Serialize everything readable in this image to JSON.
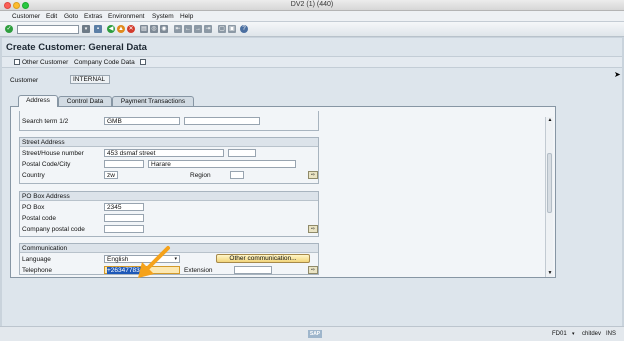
{
  "window": {
    "title": "DV2 (1) (440)"
  },
  "menu": {
    "items": [
      "Customer",
      "Edit",
      "Goto",
      "Extras",
      "Environment",
      "System",
      "Help"
    ]
  },
  "page": {
    "title": "Create Customer: General Data"
  },
  "app_toolbar": {
    "other_customer": "Other Customer",
    "company_code_data": "Company Code Data"
  },
  "customer": {
    "label": "Customer",
    "value": "INTERNAL"
  },
  "tabs": [
    {
      "label": "Address",
      "active": true
    },
    {
      "label": "Control Data",
      "active": false
    },
    {
      "label": "Payment Transactions",
      "active": false
    }
  ],
  "search": {
    "label": "Search term 1/2",
    "value1": "GMB",
    "value2": ""
  },
  "street_address": {
    "title": "Street Address",
    "street_label": "Street/House number",
    "street_value": "453 dsmaf street",
    "postal_label": "Postal Code/City",
    "postal_value": "",
    "city_value": "Harare",
    "country_label": "Country",
    "country_value": "zw",
    "region_label": "Region",
    "region_value": ""
  },
  "po_box": {
    "title": "PO Box Address",
    "po_box_label": "PO Box",
    "po_box_value": "2345",
    "postal_code_label": "Postal code",
    "postal_code_value": "",
    "company_postal_label": "Company postal code",
    "company_postal_value": ""
  },
  "communication": {
    "title": "Communication",
    "language_label": "Language",
    "language_value": "English",
    "other_comm_button": "Other communication...",
    "telephone_label": "Telephone",
    "telephone_value": "+263477834",
    "extension_label": "Extension",
    "extension_value": ""
  },
  "status": {
    "system": "FD01",
    "user": "chitdev",
    "mode": "INS",
    "logo": "SAP"
  },
  "colors": {
    "accent": "#f5a21b",
    "selection": "#1d58b8",
    "panel": "#f2f5f8"
  }
}
